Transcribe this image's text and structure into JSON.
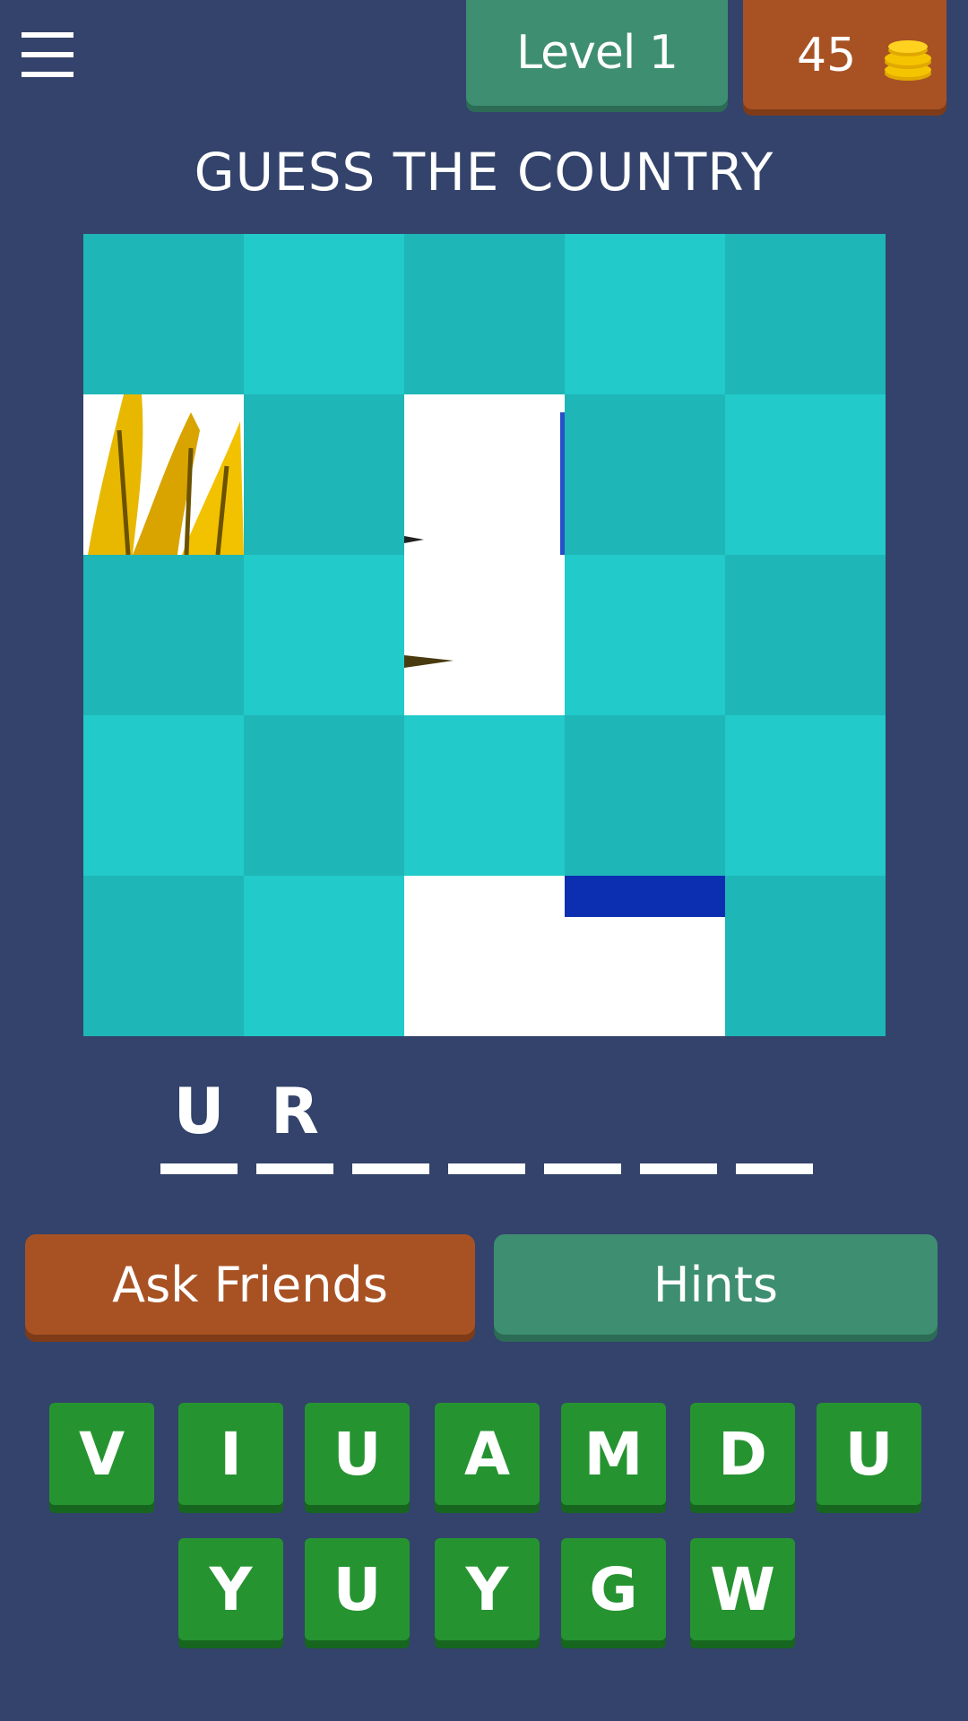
{
  "colors": {
    "background": "#33436b",
    "tile_dark": "#1fb6b7",
    "tile_light": "#22caca",
    "level_green": "#3e8e72",
    "coins_orange": "#a85224",
    "key_green": "#269331",
    "coin_gold": "#f5c400"
  },
  "header": {
    "menu_icon": "hamburger-menu-icon",
    "level_label": "Level 1",
    "coins": "45",
    "coin_icon": "coin-stack-icon"
  },
  "title": "GUESS THE COUNTRY",
  "puzzle": {
    "rows": 5,
    "cols": 5,
    "tiles": [
      "dark",
      "light",
      "dark",
      "light",
      "dark",
      "revealed",
      "dark",
      "revealed",
      "dark",
      "light",
      "dark",
      "light",
      "revealed",
      "light",
      "dark",
      "light",
      "dark",
      "light",
      "dark",
      "light",
      "dark",
      "light",
      "revealed",
      "revealed",
      "dark"
    ]
  },
  "answer": {
    "slots": [
      "U",
      "R",
      "",
      "",
      "",
      "",
      ""
    ]
  },
  "actions": {
    "ask_friends": "Ask Friends",
    "hints": "Hints"
  },
  "keyboard": {
    "row1": [
      "V",
      "I",
      "U",
      "A",
      "M",
      "D",
      "U"
    ],
    "row2": [
      "Y",
      "U",
      "Y",
      "G",
      "W"
    ]
  }
}
